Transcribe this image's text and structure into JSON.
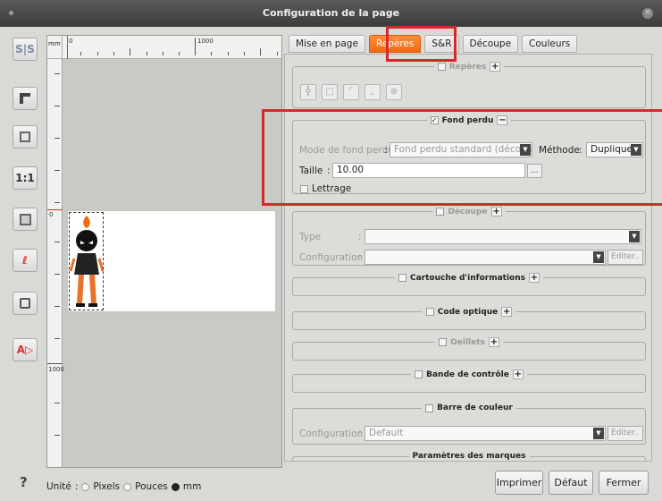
{
  "window": {
    "title": "Configuration de la page"
  },
  "toolbar": {
    "icons": [
      "spread-toggle-icon",
      "align-left-icon",
      "fit-page-icon",
      "actual-size-icon",
      "fit-window-icon",
      "link-icon",
      "frame-icon",
      "text-direction-icon"
    ],
    "actual_size_label": "1:1"
  },
  "ruler": {
    "unit": "mm",
    "top_zero": "0",
    "top_mark": "1000",
    "left_zero": "0",
    "left_mark": "1000"
  },
  "tabs": [
    {
      "label": "Mise en page"
    },
    {
      "label": "Repères"
    },
    {
      "label": "S&R"
    },
    {
      "label": "Découpe"
    },
    {
      "label": "Couleurs"
    }
  ],
  "active_tab": "Repères",
  "sections": {
    "reperes": {
      "label": "Repères",
      "toggle": "+"
    },
    "fond_perdu": {
      "label": "Fond perdu",
      "toggle": "−",
      "checked": true,
      "mode_label": "Mode de fond perdu",
      "mode_value": "Fond perdu standard (découpe)",
      "method_label": "Méthode",
      "method_value": "Dupliquer",
      "size_label": "Taille",
      "size_value": "10.00",
      "lettrage_label": "Lettrage",
      "dots": "..."
    },
    "decoupe": {
      "label": "Découpe",
      "toggle": "+",
      "type_label": "Type",
      "config_label": "Configuration",
      "edit_label": "Editer.."
    },
    "cartouche": {
      "label": "Cartouche d'informations",
      "toggle": "+"
    },
    "code_optique": {
      "label": "Code optique",
      "toggle": "+"
    },
    "oeillets": {
      "label": "Oeillets",
      "toggle": "+"
    },
    "bande": {
      "label": "Bande de contrôle",
      "toggle": "+"
    },
    "barre": {
      "label": "Barre de couleur",
      "config_label": "Configuration",
      "config_value": "Default",
      "edit_label": "Editer.."
    },
    "parametres": {
      "label": "Paramètres des marques"
    }
  },
  "colon": ":",
  "footer": {
    "help": "?",
    "unit_label": "Unité",
    "unit_options": [
      "Pixels",
      "Pouces",
      "mm"
    ],
    "unit_selected": "mm",
    "buttons": {
      "print": "Imprimer",
      "default": "Défaut",
      "close": "Fermer"
    }
  },
  "colors": {
    "accent": "#f26a10",
    "highlight": "#d42a2a"
  }
}
